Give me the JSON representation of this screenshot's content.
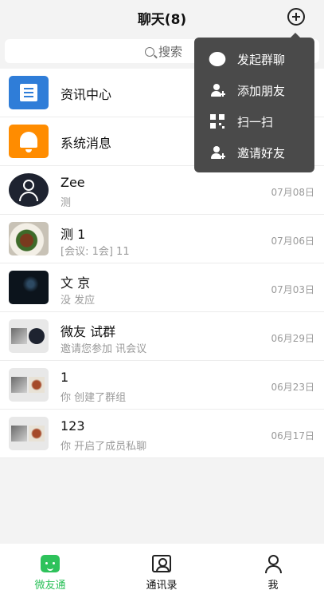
{
  "header": {
    "title": "聊天(8)"
  },
  "search": {
    "placeholder": "搜索"
  },
  "chats": [
    {
      "name": "资讯中心",
      "preview": "",
      "time": ""
    },
    {
      "name": "系统消息",
      "preview": "",
      "time": ""
    },
    {
      "name": "Zee",
      "preview": "测",
      "time": "07月08日"
    },
    {
      "name": "测  1",
      "preview": "[会议: 1会] 11",
      "time": "07月06日"
    },
    {
      "name": "文 京",
      "preview": "没  发应",
      "time": "07月03日"
    },
    {
      "name": "微友      试群",
      "preview": "邀请您参加   讯会议",
      "time": "06月29日"
    },
    {
      "name": "1",
      "preview": "你 创建了群组",
      "time": "06月23日"
    },
    {
      "name": "123",
      "preview": "你 开启了成员私聊",
      "time": "06月17日"
    }
  ],
  "menu": {
    "items": [
      {
        "label": "发起群聊",
        "icon": "chat-bubble-icon"
      },
      {
        "label": "添加朋友",
        "icon": "add-user-icon"
      },
      {
        "label": "扫一扫",
        "icon": "qr-scan-icon"
      },
      {
        "label": "邀请好友",
        "icon": "invite-user-icon"
      }
    ]
  },
  "tabs": [
    {
      "label": "微友通",
      "icon": "chat-face-icon",
      "active": true
    },
    {
      "label": "通讯录",
      "icon": "contacts-book-icon",
      "active": false
    },
    {
      "label": "我",
      "icon": "me-person-icon",
      "active": false
    }
  ],
  "colors": {
    "accent": "#2ec25b",
    "menu_bg": "#4a4a4a",
    "news_blue": "#2f7dd8",
    "bell_orange": "#ff8c00"
  }
}
